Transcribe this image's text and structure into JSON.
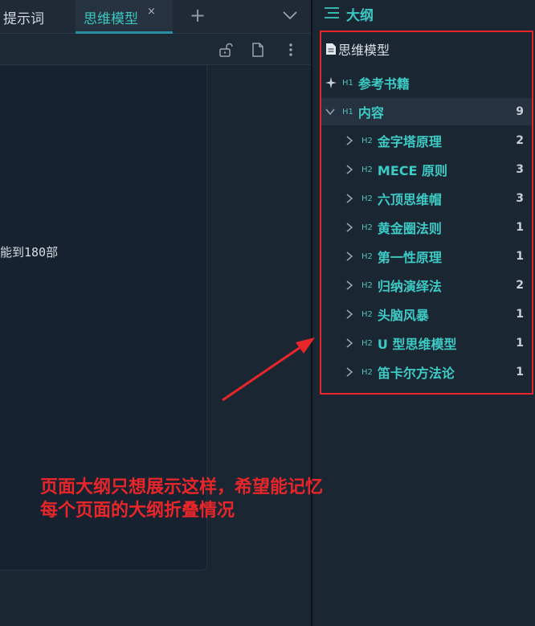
{
  "tabs": [
    {
      "label": "提示词"
    },
    {
      "label": "思维模型",
      "active": true
    }
  ],
  "tab_close_glyph": "×",
  "tab_add_glyph": "+",
  "toolbar_icons": [
    "lock-open-icon",
    "document-icon",
    "more-vertical-icon"
  ],
  "editor": {
    "visible_text": "能到180部"
  },
  "outline": {
    "title": "大纲",
    "document": {
      "label": "思维模型"
    },
    "items": [
      {
        "level": "H1",
        "label": "参考书籍",
        "icon": "sparkle-icon"
      },
      {
        "level": "H1",
        "label": "内容",
        "count": "9",
        "expanded": true
      },
      {
        "level": "H2",
        "label": "金字塔原理",
        "count": "2"
      },
      {
        "level": "H2",
        "label": "MECE 原则",
        "count": "3"
      },
      {
        "level": "H2",
        "label": "六顶思维帽",
        "count": "3"
      },
      {
        "level": "H2",
        "label": "黄金圈法则",
        "count": "1"
      },
      {
        "level": "H2",
        "label": "第一性原理",
        "count": "1"
      },
      {
        "level": "H2",
        "label": "归纳演绎法",
        "count": "2"
      },
      {
        "level": "H2",
        "label": "头脑风暴",
        "count": "1"
      },
      {
        "level": "H2",
        "label": "U 型思维模型",
        "count": "1"
      },
      {
        "level": "H2",
        "label": "笛卡尔方法论",
        "count": "1"
      }
    ]
  },
  "annotation": {
    "line1": "页面大纲只想展示这样，希望能记忆",
    "line2": "每个页面的大纲折叠情况"
  },
  "colors": {
    "accent": "#3bc7c2",
    "annotation_red": "#e8262a",
    "background": "#1b2633"
  }
}
